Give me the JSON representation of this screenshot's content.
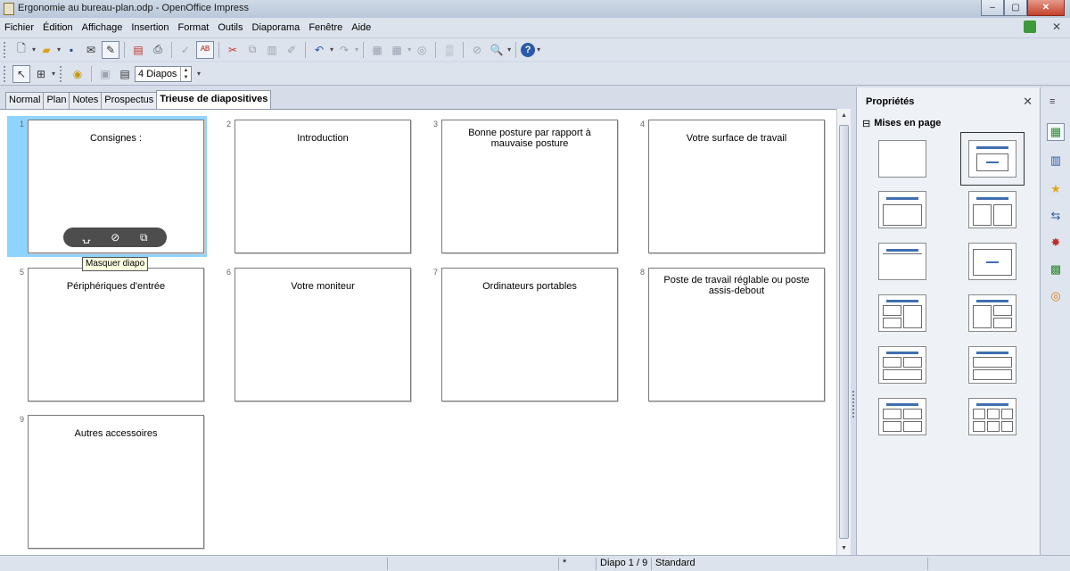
{
  "window": {
    "title": "Ergonomie au bureau-plan.odp - OpenOffice Impress",
    "min": "–",
    "max": "▢",
    "close": "✕"
  },
  "menu": [
    "Fichier",
    "Édition",
    "Affichage",
    "Insertion",
    "Format",
    "Outils",
    "Diaporama",
    "Fenêtre",
    "Aide"
  ],
  "toolbar2": {
    "slides_per_row": "4 Diapos"
  },
  "tabs": [
    "Normal",
    "Plan",
    "Notes",
    "Prospectus",
    "Trieuse de diapositives"
  ],
  "slides": [
    {
      "num": "1",
      "title": "Consignes :"
    },
    {
      "num": "2",
      "title": "Introduction"
    },
    {
      "num": "3",
      "title": "Bonne posture par rapport à mauvaise posture"
    },
    {
      "num": "4",
      "title": "Votre surface de travail"
    },
    {
      "num": "5",
      "title": "Périphériques d'entrée"
    },
    {
      "num": "6",
      "title": "Votre moniteur"
    },
    {
      "num": "7",
      "title": "Ordinateurs portables"
    },
    {
      "num": "8",
      "title": "Poste de travail réglable ou poste assis-debout"
    },
    {
      "num": "9",
      "title": "Autres accessoires"
    }
  ],
  "tooltip": "Masquer diapo",
  "properties": {
    "title": "Propriétés",
    "close": "✕",
    "section": "Mises en page",
    "section_icon": "⊟"
  },
  "status": {
    "modified": "*",
    "slide": "Diapo 1 / 9",
    "layout": "Standard"
  },
  "colors": {
    "selected_slide_bg": "#8fd3ff",
    "layout_line": "#3f6fb0"
  }
}
